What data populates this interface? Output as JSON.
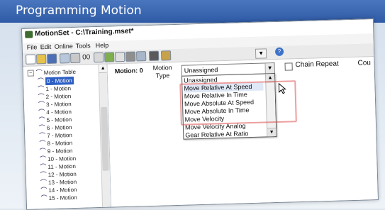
{
  "slide": {
    "title": "Programming Motion"
  },
  "window": {
    "title": "MotionSet - C:\\Training.mset*"
  },
  "menu": [
    "File",
    "Edit",
    "Online",
    "Tools",
    "Help"
  ],
  "toolbar": {
    "text_00": "00",
    "help_icon": "question-icon"
  },
  "tree": {
    "root": "Motion Table",
    "items": [
      "0 - Motion",
      "1 - Motion",
      "2 - Motion",
      "3 - Motion",
      "4 - Motion",
      "5 - Motion",
      "6 - Motion",
      "7 - Motion",
      "8 - Motion",
      "9 - Motion",
      "10 - Motion",
      "11 - Motion",
      "12 - Motion",
      "13 - Motion",
      "14 - Motion",
      "15 - Motion"
    ],
    "selected_index": 0
  },
  "main": {
    "motion_label": "Motion: 0",
    "motion_type_label_line1": "Motion",
    "motion_type_label_line2": "Type",
    "motion_type_value": "Unassigned",
    "chain_repeat_label": "Chain Repeat",
    "truncated_label": "Cou"
  },
  "dropdown": {
    "options": [
      "Unassigned",
      "Move Relative At Speed",
      "Move Relative In Time",
      "Move Absolute At Speed",
      "Move Absolute In Time",
      "Move Velocity",
      "Move Velocity Analog",
      "Gear Relative At Ratio"
    ],
    "hovered_index": 1
  },
  "colors": {
    "header_blue": "#2f5aa5",
    "selection_blue": "#2d5fc4",
    "highlight_red": "#dc5050"
  }
}
